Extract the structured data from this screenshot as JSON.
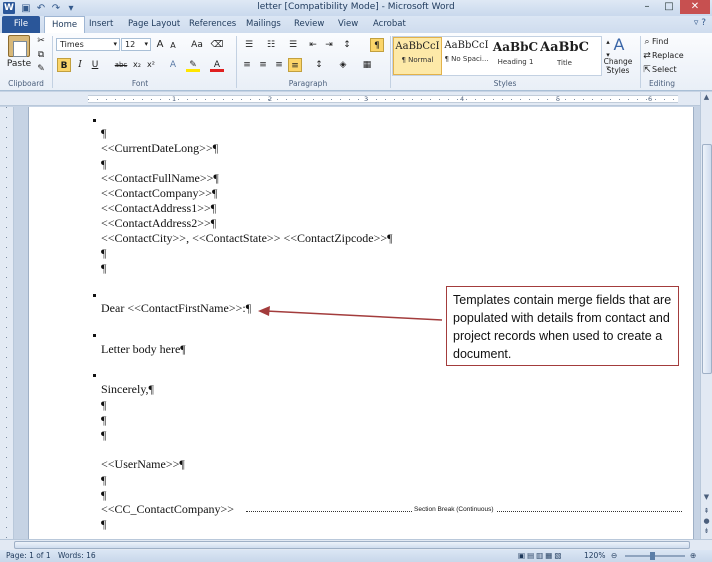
{
  "window": {
    "title": "letter [Compatibility Mode] - Microsoft Word",
    "app_icon": "W",
    "controls": [
      "–",
      "□",
      "✕"
    ]
  },
  "qat": [
    "save-icon",
    "undo-icon",
    "redo-icon",
    "customize-icon"
  ],
  "tabs": [
    "File",
    "Home",
    "Insert",
    "Page Layout",
    "References",
    "Mailings",
    "Review",
    "View",
    "Acrobat"
  ],
  "ribbon": {
    "clipboard": {
      "paste": "Paste",
      "label": "Clipboard"
    },
    "font": {
      "name": "Times",
      "size": "12",
      "label": "Font",
      "bold": "B",
      "italic": "I",
      "underline": "U",
      "strike": "abc",
      "sub": "x₂",
      "sup": "x²",
      "grow": "A",
      "shrink": "A",
      "case": "Aa"
    },
    "paragraph": {
      "label": "Paragraph",
      "pilcrow": "¶"
    },
    "styles": {
      "label": "Styles",
      "items": [
        {
          "sample": "AaBbCcI",
          "name": "¶ Normal"
        },
        {
          "sample": "AaBbCcI",
          "name": "¶ No Spaci..."
        },
        {
          "sample": "AaBbC",
          "name": "Heading 1"
        },
        {
          "sample": "AaBbC",
          "name": "Title"
        }
      ],
      "change": "Change Styles"
    },
    "editing": {
      "label": "Editing",
      "find": "Find",
      "replace": "Replace",
      "select": "Select"
    }
  },
  "ruler": [
    "1",
    "2",
    "3",
    "4",
    "5",
    "6"
  ],
  "document": {
    "lines": [
      "¶",
      "<<CurrentDateLong>>¶",
      "¶",
      "<<ContactFullName>>¶",
      "<<ContactCompany>>¶",
      "<<ContactAddress1>>¶",
      "<<ContactAddress2>>¶",
      "<<ContactCity>>, <<ContactState>> <<ContactZipcode>>¶",
      "¶",
      "¶",
      "Dear <<ContactFirstName>>:¶",
      "Letter body here¶",
      "Sincerely,¶",
      "¶",
      "¶",
      "¶",
      "<<UserName>>¶",
      "¶",
      "¶",
      "<<CC_ContactCompany>>",
      "¶"
    ],
    "section_break": "Section Break (Continuous)"
  },
  "callout": {
    "text": "Templates contain merge fields that are populated with details from contact and project records when used to create a document."
  },
  "status": {
    "page": "Page: 1 of 1",
    "words": "Words: 16",
    "zoom": "120%"
  },
  "colors": {
    "file_tab": "#2a5699",
    "callout_border": "#a33c3c",
    "arrow": "#a33c3c",
    "highlight": "#fbd56a"
  }
}
